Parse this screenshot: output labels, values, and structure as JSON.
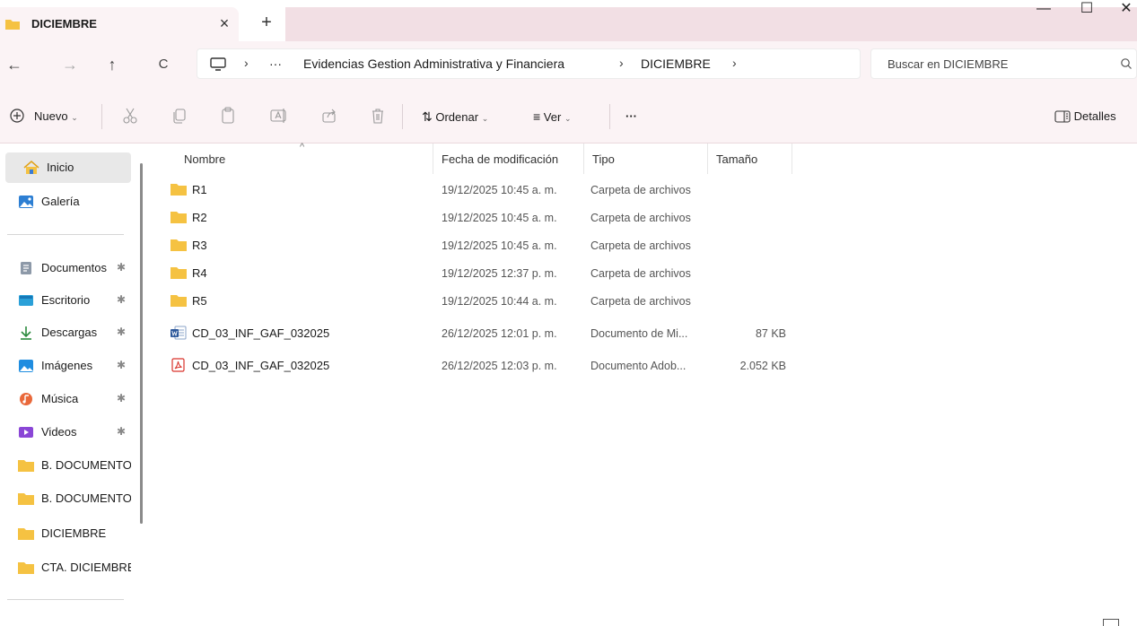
{
  "tab": {
    "title": "DICIEMBRE",
    "close": "×",
    "new_tab": "+"
  },
  "window": {
    "minimize": "—",
    "maximize": "☐",
    "close": "✕"
  },
  "nav": {
    "back": "←",
    "forward": "→",
    "up": "↑",
    "refresh": "C"
  },
  "address": {
    "more": "···",
    "sep": "›",
    "crumbs": [
      "Evidencias Gestion Administrativa y Financiera",
      "DICIEMBRE"
    ]
  },
  "search": {
    "placeholder": "Buscar en DICIEMBRE"
  },
  "commands": {
    "new_label": "Nuevo",
    "sort_label": "Ordenar",
    "view_label": "Ver",
    "more_label": "···",
    "details_label": "Detalles"
  },
  "sidebar": {
    "items": [
      {
        "label": "Inicio",
        "icon": "home-icon",
        "pinned": false,
        "selected": true
      },
      {
        "label": "Galería",
        "icon": "gallery-icon",
        "pinned": false
      },
      {
        "label": "Documentos",
        "icon": "documents-icon",
        "pinned": true
      },
      {
        "label": "Escritorio",
        "icon": "desktop-icon",
        "pinned": true
      },
      {
        "label": "Descargas",
        "icon": "downloads-icon",
        "pinned": true
      },
      {
        "label": "Imágenes",
        "icon": "pictures-icon",
        "pinned": true
      },
      {
        "label": "Música",
        "icon": "music-icon",
        "pinned": true
      },
      {
        "label": "Videos",
        "icon": "videos-icon",
        "pinned": true
      },
      {
        "label": "B. DOCUMENTOS",
        "icon": "folder-icon",
        "pinned": false
      },
      {
        "label": "B. DOCUMENTOS",
        "icon": "folder-icon",
        "pinned": false
      },
      {
        "label": "DICIEMBRE",
        "icon": "folder-icon",
        "pinned": false
      },
      {
        "label": "CTA. DICIEMBRE",
        "icon": "folder-icon",
        "pinned": false
      }
    ]
  },
  "columns": {
    "name": "Nombre",
    "date": "Fecha de modificación",
    "type": "Tipo",
    "size": "Tamaño"
  },
  "files": [
    {
      "name": "R1",
      "date": "19/12/2025 10:45 a. m.",
      "type": "Carpeta de archivos",
      "size": "",
      "icon": "folder-icon"
    },
    {
      "name": "R2",
      "date": "19/12/2025 10:45 a. m.",
      "type": "Carpeta de archivos",
      "size": "",
      "icon": "folder-icon"
    },
    {
      "name": "R3",
      "date": "19/12/2025 10:45 a. m.",
      "type": "Carpeta de archivos",
      "size": "",
      "icon": "folder-icon"
    },
    {
      "name": "R4",
      "date": "19/12/2025 12:37 p. m.",
      "type": "Carpeta de archivos",
      "size": "",
      "icon": "folder-icon"
    },
    {
      "name": "R5",
      "date": "19/12/2025 10:44 a. m.",
      "type": "Carpeta de archivos",
      "size": "",
      "icon": "folder-icon"
    },
    {
      "name": "CD_03_INF_GAF_032025",
      "date": "26/12/2025 12:01 p. m.",
      "type": "Documento de Mi...",
      "size": "87 KB",
      "icon": "word-doc-icon"
    },
    {
      "name": "CD_03_INF_GAF_032025",
      "date": "26/12/2025 12:03 p. m.",
      "type": "Documento Adob...",
      "size": "2.052 KB",
      "icon": "pdf-doc-icon"
    }
  ],
  "colors": {
    "accent_bg": "#fbf3f5",
    "tab_strip": "#f2dfe4",
    "folder": "#f5c242",
    "pdf": "#d9332b",
    "word": "#2b579a"
  }
}
